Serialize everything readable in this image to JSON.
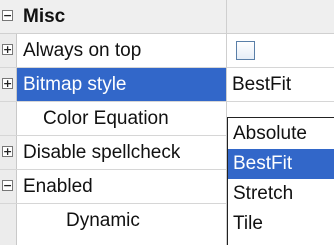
{
  "property_grid": {
    "category": {
      "label": "Misc",
      "expander": "−"
    },
    "rows": [
      {
        "label": "Always on top",
        "expander": "+"
      },
      {
        "label": "Bitmap style",
        "expander": "+",
        "value": "BestFit"
      },
      {
        "label": "Color Equation"
      },
      {
        "label": "Disable spellcheck",
        "expander": "+"
      },
      {
        "label": "Enabled",
        "expander": "−"
      },
      {
        "label": "Dynamic"
      }
    ]
  },
  "dropdown": {
    "options": [
      "Absolute",
      "BestFit",
      "Stretch",
      "Tile"
    ],
    "selected": "BestFit"
  },
  "colors": {
    "selection": "#3267c9",
    "category_bg": "#efefef",
    "gutter_bg": "#ececec"
  }
}
